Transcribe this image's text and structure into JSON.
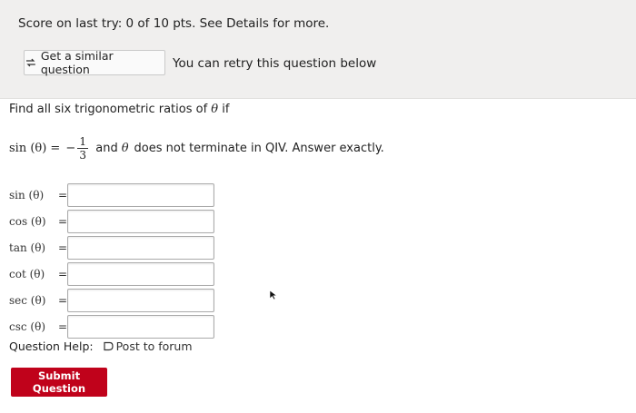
{
  "score_text": "Score on last try: 0 of 10 pts. See Details for more.",
  "similar_button": "Get a similar question",
  "retry_text": "You can retry this question below",
  "question": {
    "prompt_prefix": "Find all six trigonometric ratios of",
    "prompt_theta": "θ",
    "prompt_suffix": "if",
    "given_lhs": "sin (θ) =",
    "given_sign": "−",
    "given_num": "1",
    "given_den": "3",
    "given_tail_1": "and",
    "given_theta": "θ",
    "given_tail_2": "does not terminate in QIV. Answer exactly."
  },
  "answers": [
    {
      "label": "sin (θ)",
      "value": ""
    },
    {
      "label": "cos (θ)",
      "value": ""
    },
    {
      "label": "tan (θ)",
      "value": ""
    },
    {
      "label": "cot (θ)",
      "value": ""
    },
    {
      "label": "sec (θ)",
      "value": ""
    },
    {
      "label": "csc (θ)",
      "value": ""
    }
  ],
  "equals": "=",
  "help_label": "Question Help:",
  "forum_link": "Post to forum",
  "submit_label": "Submit Question",
  "colors": {
    "submit_bg": "#c0021b",
    "top_bg": "#f0efee"
  }
}
